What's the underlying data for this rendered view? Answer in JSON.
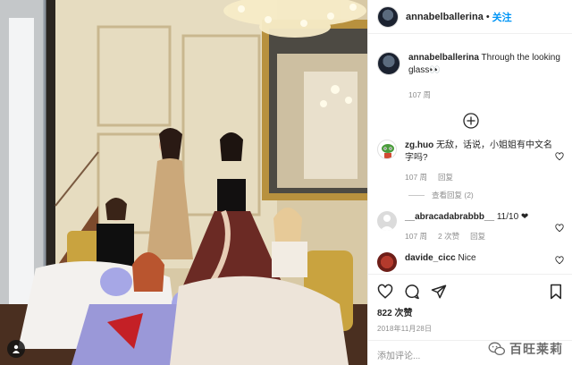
{
  "post": {
    "username": "annabelballerina",
    "follow_label": "关注",
    "dot": "•",
    "caption_text": "Through the looking glass👀",
    "caption_time": "107 周"
  },
  "comments": [
    {
      "username": "zg.huo",
      "text": "无敌，话说，小姐姐有中文名字吗?",
      "time": "107 周",
      "reply_label": "回复",
      "view_replies": "查看回复 (2)"
    },
    {
      "username": "__abracadabrabbb__",
      "text": "11/10 ❤",
      "time": "107 周",
      "likes": "2 次赞",
      "reply_label": "回复"
    },
    {
      "username": "davide_cicc",
      "text": "Nice"
    }
  ],
  "actions": {
    "likes": "822 次赞",
    "date": "2018年11月28日",
    "add_comment_placeholder": "添加评论..."
  },
  "watermark": {
    "text": "百旺莱莉"
  },
  "icons": {
    "user_tag": "user-tag-icon",
    "load_more": "plus-circle-icon",
    "like": "heart-icon",
    "comment": "comment-icon",
    "share": "paper-plane-icon",
    "save": "bookmark-icon"
  },
  "colors": {
    "follow_blue": "#0095f6",
    "meta_grey": "#8e8e8e",
    "text": "#262626"
  }
}
